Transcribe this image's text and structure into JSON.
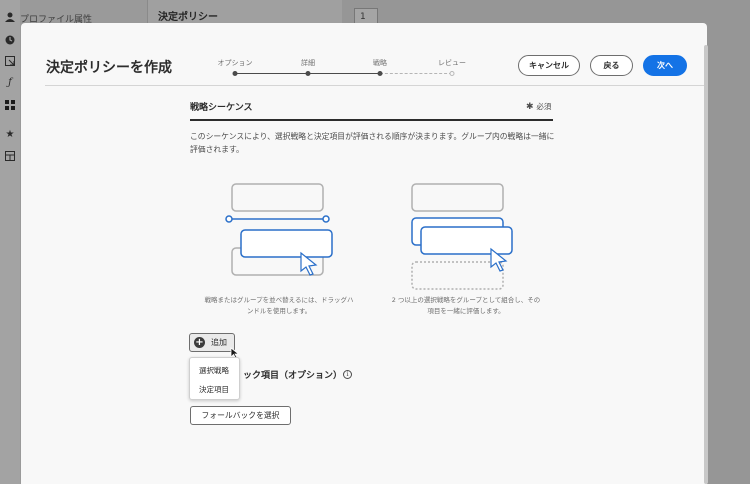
{
  "background": {
    "left_panel_label": "プロファイル属性",
    "middle_title": "決定ポリシー",
    "right_tag": "1"
  },
  "rail_icons": [
    "user-icon",
    "clock-icon",
    "open-in-icon",
    "function-icon",
    "grid-icon",
    "star-icon",
    "table-icon"
  ],
  "modal": {
    "title": "決定ポリシーを作成",
    "steps": [
      {
        "label": "オプション",
        "state": "done"
      },
      {
        "label": "詳細",
        "state": "done"
      },
      {
        "label": "戦略",
        "state": "current"
      },
      {
        "label": "レビュー",
        "state": "pending"
      }
    ],
    "buttons": {
      "cancel": "キャンセル",
      "back": "戻る",
      "next": "次へ"
    },
    "section": {
      "title": "戦略シーケンス",
      "required_label": "必須",
      "description": "このシーケンスにより、選択戦略と決定項目が評価される順序が決まります。グループ内の戦略は一緒に評価されます。"
    },
    "illustrations": {
      "reorder_caption": "戦略またはグループを並べ替えるには、ドラッグハンドルを使用します。",
      "group_caption": "2 つ以上の選択戦略をグループとして組合し、その項目を一緒に評価します。"
    },
    "add_button_label": "追加",
    "add_menu": [
      "選択戦略",
      "決定項目"
    ],
    "fallback": {
      "title": "フォールバック項目（オプション）",
      "title_visible": "ック項目（オプション）",
      "button_label": "フォールバックを選択"
    }
  },
  "colors": {
    "accent": "#1473e6",
    "illustration_blue": "#2a6fc9",
    "text": "#2c2c2c"
  }
}
